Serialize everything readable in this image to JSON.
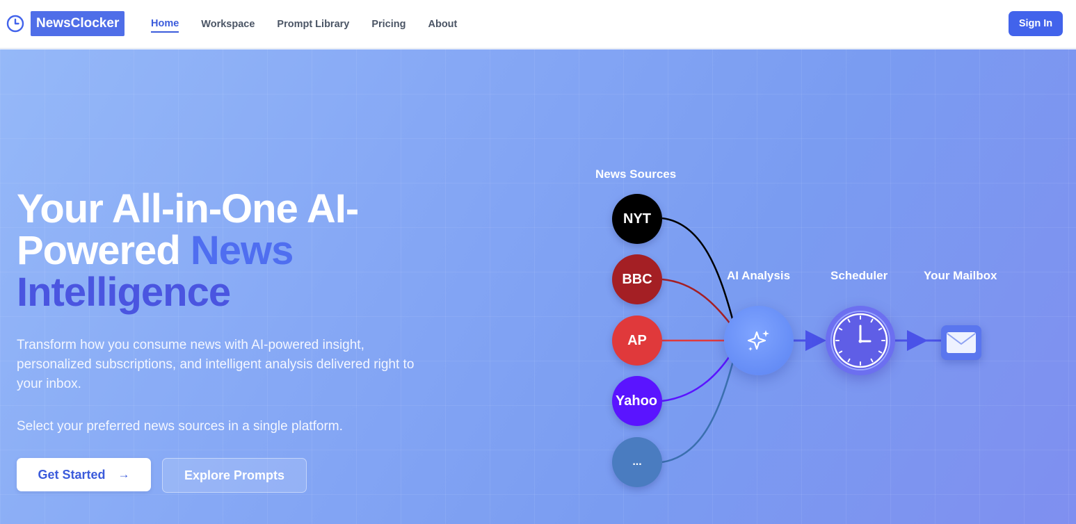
{
  "nav": {
    "brand": "NewsClocker",
    "links": [
      "Home",
      "Workspace",
      "Prompt Library",
      "Pricing",
      "About"
    ],
    "active": "Home",
    "signin": "Sign In"
  },
  "hero": {
    "headline_part1": "Your All-in-One AI-Powered ",
    "headline_accent1": "News",
    "headline_accent2": "Intelligence",
    "description": "Transform how you consume news with AI-powered insight, personalized subscriptions, and intelligent analysis delivered right to your inbox.",
    "subdescription": "Select your preferred news sources in a single platform.",
    "primary_button": "Get Started",
    "primary_button_icon": "arrow-right-icon",
    "secondary_button": "Explore Prompts"
  },
  "diagram": {
    "sources_label": "News Sources",
    "sources": [
      {
        "label": "NYT",
        "color": "#000000"
      },
      {
        "label": "BBC",
        "color": "#a41f24"
      },
      {
        "label": "AP",
        "color": "#e0393b"
      },
      {
        "label": "Yahoo",
        "color": "#5a14ff"
      },
      {
        "label": "...",
        "color": "#4a7cc0"
      }
    ],
    "ai_label": "AI Analysis",
    "scheduler_label": "Scheduler",
    "mailbox_label": "Your Mailbox",
    "icons": {
      "ai": "sparkles-icon",
      "scheduler": "clock-icon",
      "mailbox": "envelope-icon"
    }
  },
  "colors": {
    "brand": "#4f6ee8",
    "accent": "#4263eb",
    "hero_bg": "#86a8f5"
  }
}
